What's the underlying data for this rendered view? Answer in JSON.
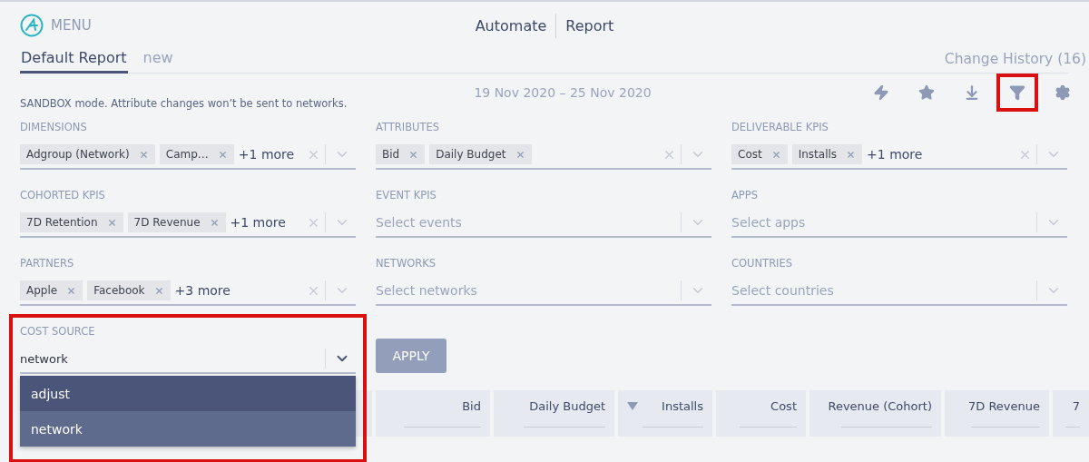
{
  "header": {
    "menu_label": "MENU",
    "nav": [
      "Automate",
      "Report"
    ]
  },
  "tabs": [
    {
      "label": "Default Report",
      "selected": true
    },
    {
      "label": "new",
      "selected": false
    }
  ],
  "change_history": "Change History (16)",
  "notice": "SANDBOX mode. Attribute changes won’t be sent to networks.",
  "date_range": "19 Nov 2020 – 25 Nov 2020",
  "toolbar": [
    {
      "kind": "bolt",
      "highlighted": false
    },
    {
      "kind": "star",
      "highlighted": false
    },
    {
      "kind": "download",
      "highlighted": false
    },
    {
      "kind": "filter",
      "highlighted": true
    },
    {
      "kind": "settings",
      "highlighted": false
    }
  ],
  "filters": [
    {
      "label": "DIMENSIONS",
      "chips": [
        "Adgroup (Network)",
        "Camp…"
      ],
      "more": "+1 more"
    },
    {
      "label": "ATTRIBUTES",
      "chips": [
        "Bid",
        "Daily Budget"
      ]
    },
    {
      "label": "DELIVERABLE KPIS",
      "chips": [
        "Cost",
        "Installs"
      ],
      "more": "+1 more"
    },
    {
      "label": "COHORTED KPIS",
      "chips": [
        "7D Retention",
        "7D Revenue"
      ],
      "more": "+1 more"
    },
    {
      "label": "EVENT KPIS",
      "placeholder": "Select events"
    },
    {
      "label": "APPS",
      "placeholder": "Select apps"
    },
    {
      "label": "PARTNERS",
      "chips": [
        "Apple",
        "Facebook"
      ],
      "more": "+3 more"
    },
    {
      "label": "NETWORKS",
      "placeholder": "Select networks"
    },
    {
      "label": "COUNTRIES",
      "placeholder": "Select countries"
    }
  ],
  "cost_source": {
    "label": "COST SOURCE",
    "value": "network",
    "expanded": true,
    "highlighted": true,
    "options": [
      {
        "label": "adjust",
        "selected": false
      },
      {
        "label": "network",
        "selected": true
      }
    ]
  },
  "apply_button": "APPLY",
  "table": {
    "columns": [
      {
        "label": "Bid",
        "sorted": false
      },
      {
        "label": "Daily Budget",
        "sorted": false
      },
      {
        "label": "Installs",
        "sorted": true
      },
      {
        "label": "Cost",
        "sorted": false
      },
      {
        "label": "Revenue (Cohort)",
        "sorted": false
      },
      {
        "label": "7D Revenue",
        "sorted": false
      },
      {
        "label": "7",
        "sorted": false
      }
    ]
  }
}
